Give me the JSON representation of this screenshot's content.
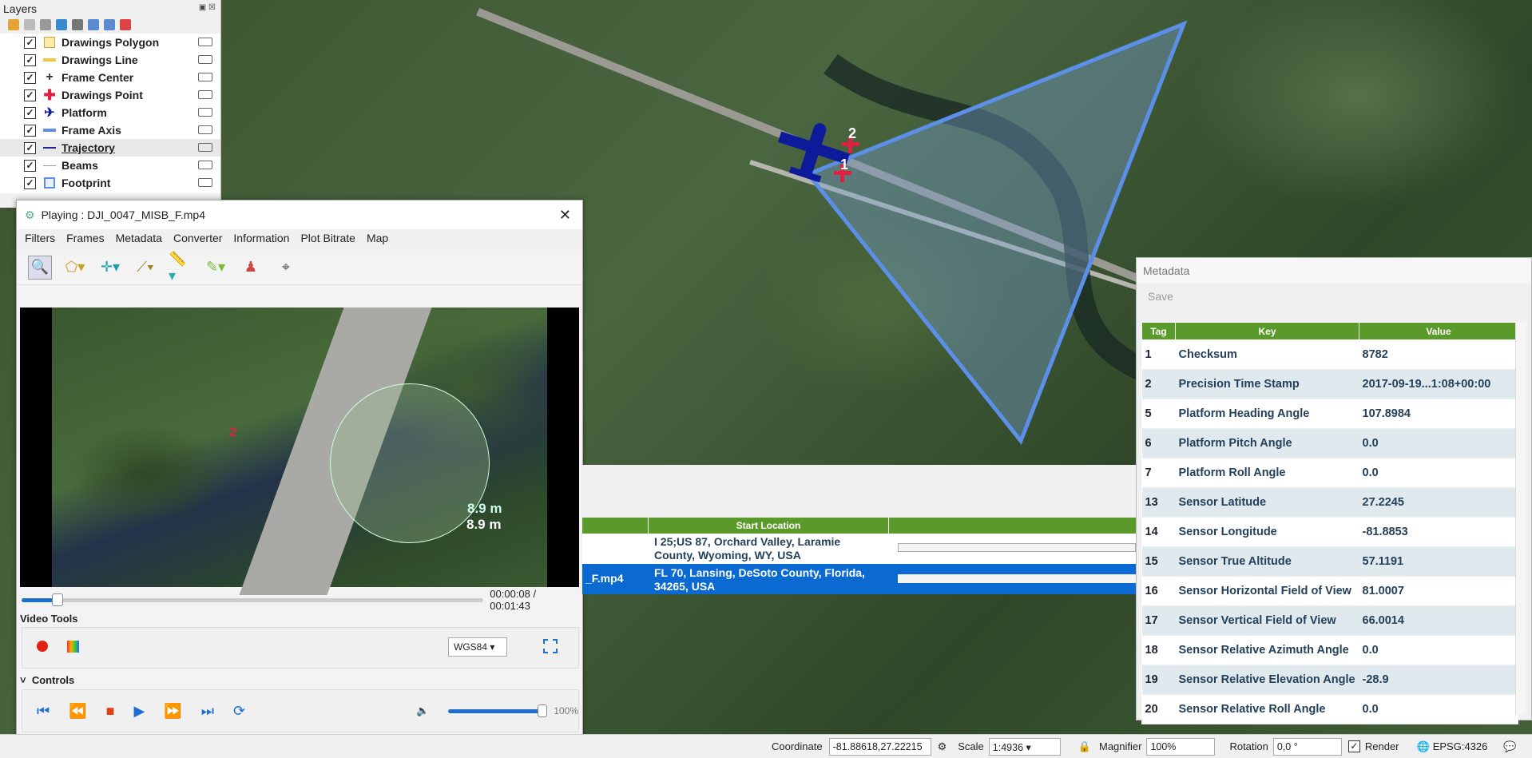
{
  "layers": {
    "title": "Layers",
    "items": [
      {
        "label": "Drawings Polygon",
        "checked": true,
        "symbol": "polygon-fill"
      },
      {
        "label": "Drawings Line",
        "checked": true,
        "symbol": "line-yellow"
      },
      {
        "label": "Frame Center",
        "checked": true,
        "symbol": "crosshair"
      },
      {
        "label": "Drawings Point",
        "checked": true,
        "symbol": "red-cross"
      },
      {
        "label": "Platform",
        "checked": true,
        "symbol": "plane"
      },
      {
        "label": "Frame Axis",
        "checked": true,
        "symbol": "line-blue"
      },
      {
        "label": "Trajectory",
        "checked": true,
        "symbol": "line-navy"
      },
      {
        "label": "Beams",
        "checked": true,
        "symbol": "line-gray"
      },
      {
        "label": "Footprint",
        "checked": true,
        "symbol": "polygon-blue"
      }
    ]
  },
  "player": {
    "title": "Playing : DJI_0047_MISB_F.mp4",
    "menu": [
      "Filters",
      "Frames",
      "Metadata",
      "Converter",
      "Information",
      "Plot Bitrate",
      "Map"
    ],
    "distance_label_1": "8.9 m",
    "distance_label_2": "8.9 m",
    "marker": "2",
    "time": "00:00:08 / 00:01:43",
    "progress": 0.078,
    "video_tools_label": "Video Tools",
    "crs": "WGS84",
    "controls_label": "Controls",
    "volume": "100%"
  },
  "map": {
    "marker_1": "1",
    "marker_2": "2"
  },
  "grid": {
    "header": "Start Location",
    "rows": [
      {
        "file": "",
        "location": "I 25;US 87, Orchard Valley, Laramie County, Wyoming, WY, USA"
      },
      {
        "file": "_F.mp4",
        "location": "FL 70, Lansing, DeSoto County, Florida, 34265, USA"
      }
    ]
  },
  "metadata": {
    "title": "Metadata",
    "save": "Save",
    "columns": [
      "Tag",
      "Key",
      "Value"
    ],
    "rows": [
      [
        "1",
        "Checksum",
        "8782"
      ],
      [
        "2",
        "Precision Time Stamp",
        "2017-09-19...1:08+00:00"
      ],
      [
        "5",
        "Platform Heading Angle",
        "107.8984"
      ],
      [
        "6",
        "Platform Pitch Angle",
        "0.0"
      ],
      [
        "7",
        "Platform Roll Angle",
        "0.0"
      ],
      [
        "13",
        "Sensor Latitude",
        "27.2245"
      ],
      [
        "14",
        "Sensor Longitude",
        "-81.8853"
      ],
      [
        "15",
        "Sensor True Altitude",
        "57.1191"
      ],
      [
        "16",
        "Sensor Horizontal Field of View",
        "81.0007"
      ],
      [
        "17",
        "Sensor Vertical Field of View",
        "66.0014"
      ],
      [
        "18",
        "Sensor Relative Azimuth Angle",
        "0.0"
      ],
      [
        "19",
        "Sensor Relative Elevation Angle",
        "-28.9"
      ],
      [
        "20",
        "Sensor Relative Roll Angle",
        "0.0"
      ]
    ]
  },
  "status": {
    "coordinate_label": "Coordinate",
    "coordinate": "-81.88618,27.22215",
    "scale_label": "Scale",
    "scale": "1:4936",
    "magnifier_label": "Magnifier",
    "magnifier": "100%",
    "rotation_label": "Rotation",
    "rotation": "0,0 °",
    "render_label": "Render",
    "crs": "EPSG:4326"
  },
  "colors": {
    "accent": "#1e6fd0",
    "header_green": "#5a9a2a",
    "footprint": "#5b8fe8"
  }
}
